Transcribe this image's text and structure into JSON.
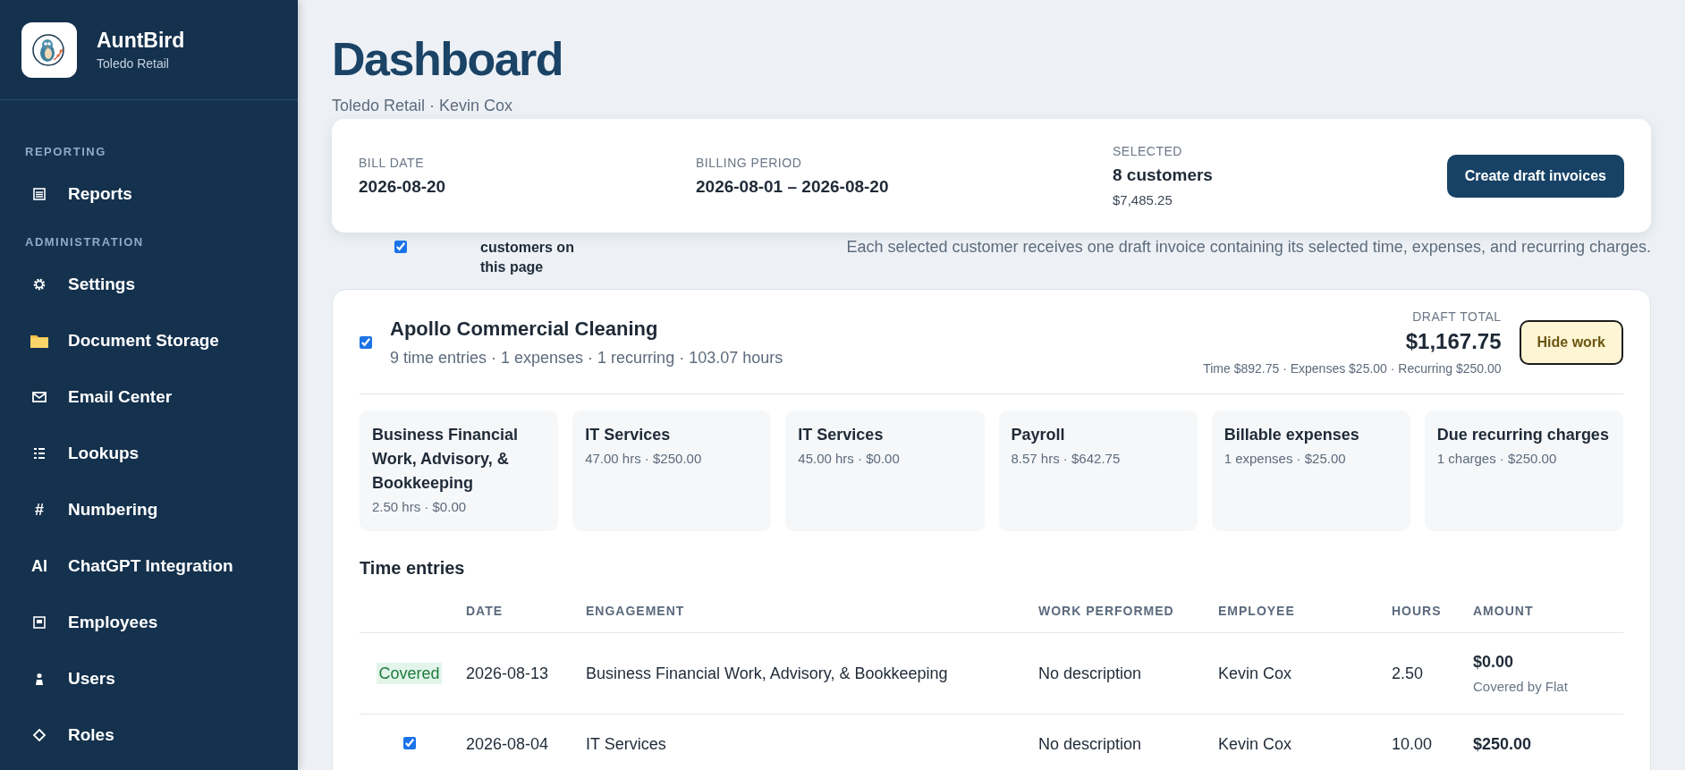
{
  "app": {
    "name": "AuntBird",
    "org": "Toledo Retail"
  },
  "sidebar": {
    "sections": [
      {
        "title": "REPORTING",
        "items": [
          {
            "label": "Reports",
            "kind": "list",
            "selected": false
          }
        ]
      },
      {
        "title": "ADMINISTRATION",
        "items": [
          {
            "label": "Settings",
            "kind": "gear",
            "selected": false
          },
          {
            "label": "Document Storage",
            "kind": "folder",
            "selected": false
          },
          {
            "label": "Email Center",
            "kind": "envelope",
            "selected": false
          },
          {
            "label": "Lookups",
            "kind": "lines",
            "selected": false
          },
          {
            "label": "Numbering",
            "kind": "glyph",
            "glyph": "#",
            "selected": false
          },
          {
            "label": "ChatGPT Integration",
            "kind": "glyph",
            "glyph": "AI",
            "selected": false
          },
          {
            "label": "Employees",
            "kind": "card",
            "selected": false
          },
          {
            "label": "Users",
            "kind": "person",
            "selected": false
          },
          {
            "label": "Roles",
            "kind": "diamond",
            "selected": false
          }
        ]
      }
    ]
  },
  "page": {
    "title": "Dashboard",
    "subtitle": "Toledo Retail · Kevin Cox"
  },
  "summary": {
    "fields": [
      {
        "label": "BILL DATE",
        "value": "2026-08-20"
      },
      {
        "label": "BILLING PERIOD",
        "value": "2026-08-01 – 2026-08-20"
      },
      {
        "label": "SELECTED",
        "value": "8 customers",
        "note": "$7,485.25"
      }
    ],
    "button": "Create draft invoices"
  },
  "select_all": {
    "checked": true,
    "label": "customers on this page",
    "note": "Each selected customer receives one draft invoice containing its selected time, expenses, and recurring charges."
  },
  "customer": {
    "checked": true,
    "name": "Apollo Commercial Cleaning",
    "stats": "9 time entries · 1 expenses · 1 recurring · 103.07 hours",
    "total_label": "DRAFT TOTAL",
    "total": "$1,167.75",
    "breakdown": "Time $892.75 · Expenses $25.00 · Recurring $250.00",
    "button": "Hide work",
    "tiles": [
      {
        "title": "Business Financial Work, Advisory, & Bookkeeping",
        "detail": "2.50 hrs · $0.00"
      },
      {
        "title": "IT Services",
        "detail": "47.00 hrs · $250.00"
      },
      {
        "title": "IT Services",
        "detail": "45.00 hrs · $0.00"
      },
      {
        "title": "Payroll",
        "detail": "8.57 hrs · $642.75"
      },
      {
        "title": "Billable expenses",
        "detail": "1 expenses · $25.00"
      },
      {
        "title": "Due recurring charges",
        "detail": "1 charges · $250.00"
      }
    ],
    "time_entries": {
      "title": "Time entries",
      "columns": [
        "DATE",
        "ENGAGEMENT",
        "WORK PERFORMED",
        "EMPLOYEE",
        "HOURS",
        "AMOUNT"
      ],
      "rows": [
        {
          "kind": "covered",
          "status": "Covered",
          "date": "2026-08-13",
          "engagement": "Business Financial Work, Advisory, & Bookkeeping",
          "work": "No description",
          "employee": "Kevin Cox",
          "hours": "2.50",
          "amount": "$0.00",
          "amount_note": "Covered by Flat"
        },
        {
          "kind": "checkbox",
          "checked": true,
          "date": "2026-08-04",
          "engagement": "IT Services",
          "work": "No description",
          "employee": "Kevin Cox",
          "hours": "10.00",
          "amount": "$250.00"
        }
      ]
    }
  }
}
